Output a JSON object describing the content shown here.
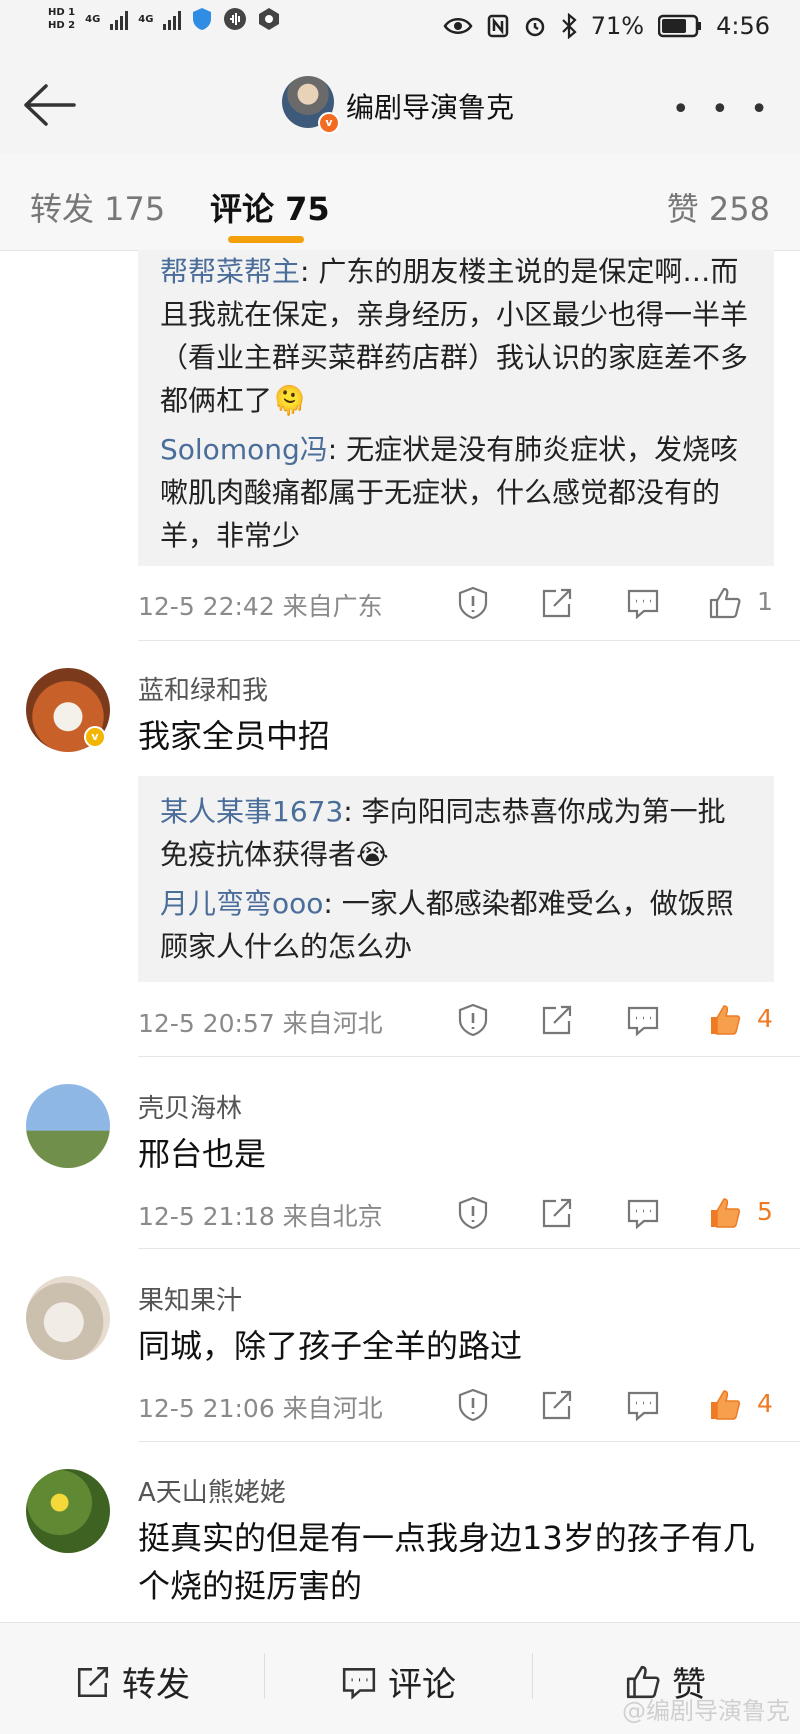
{
  "status_bar": {
    "hd1": "HD 1",
    "hd2": "HD 2",
    "net1": "4G",
    "net2": "4G",
    "battery": "71%",
    "time": "4:56"
  },
  "header": {
    "title": "编剧导演鲁克",
    "more": "• • •"
  },
  "tabs": {
    "repost": "转发 175",
    "comments": "评论 75",
    "likes": "赞 258"
  },
  "comments": [
    {
      "replies": [
        {
          "user": "帮帮菜帮主",
          "text": ": 广东的朋友楼主说的是保定啊…而且我就在保定，亲身经历，小区最少也得一半羊（看业主群买菜群药店群）我认识的家庭差不多都俩杠了🫠"
        },
        {
          "user": "Solomong冯",
          "text": ": 无症状是没有肺炎症状，发烧咳嗽肌肉酸痛都属于无症状，什么感觉都没有的羊，非常少"
        }
      ],
      "meta": "12-5 22:42  来自广东",
      "like_count": "1"
    },
    {
      "user": "蓝和绿和我",
      "text": "我家全员中招",
      "replies": [
        {
          "user": "某人某事1673",
          "text": ": 李向阳同志恭喜你成为第一批免疫抗体获得者😭"
        },
        {
          "user": "月儿弯弯ooo",
          "text": ": 一家人都感染都难受么，做饭照顾家人什么的怎么办"
        }
      ],
      "meta": "12-5 20:57  来自河北",
      "like_count": "4"
    },
    {
      "user": "壳贝海林",
      "text": "邢台也是",
      "meta": "12-5 21:18  来自北京",
      "like_count": "5"
    },
    {
      "user": "果知果汁",
      "text": "同城，除了孩子全羊的路过",
      "meta": "12-5 21:06  来自河北",
      "like_count": "4"
    },
    {
      "user": "A天山熊姥姥",
      "text": "挺真实的但是有一点我身边13岁的孩子有几个烧的挺厉害的"
    }
  ],
  "bottom_bar": {
    "repost": "转发",
    "comment": "评论",
    "like": "赞"
  },
  "watermark": "@编剧导演鲁克",
  "colors": {
    "accent": "#f3a00d",
    "link": "#4a6d9a",
    "liked": "#ef7a24"
  }
}
